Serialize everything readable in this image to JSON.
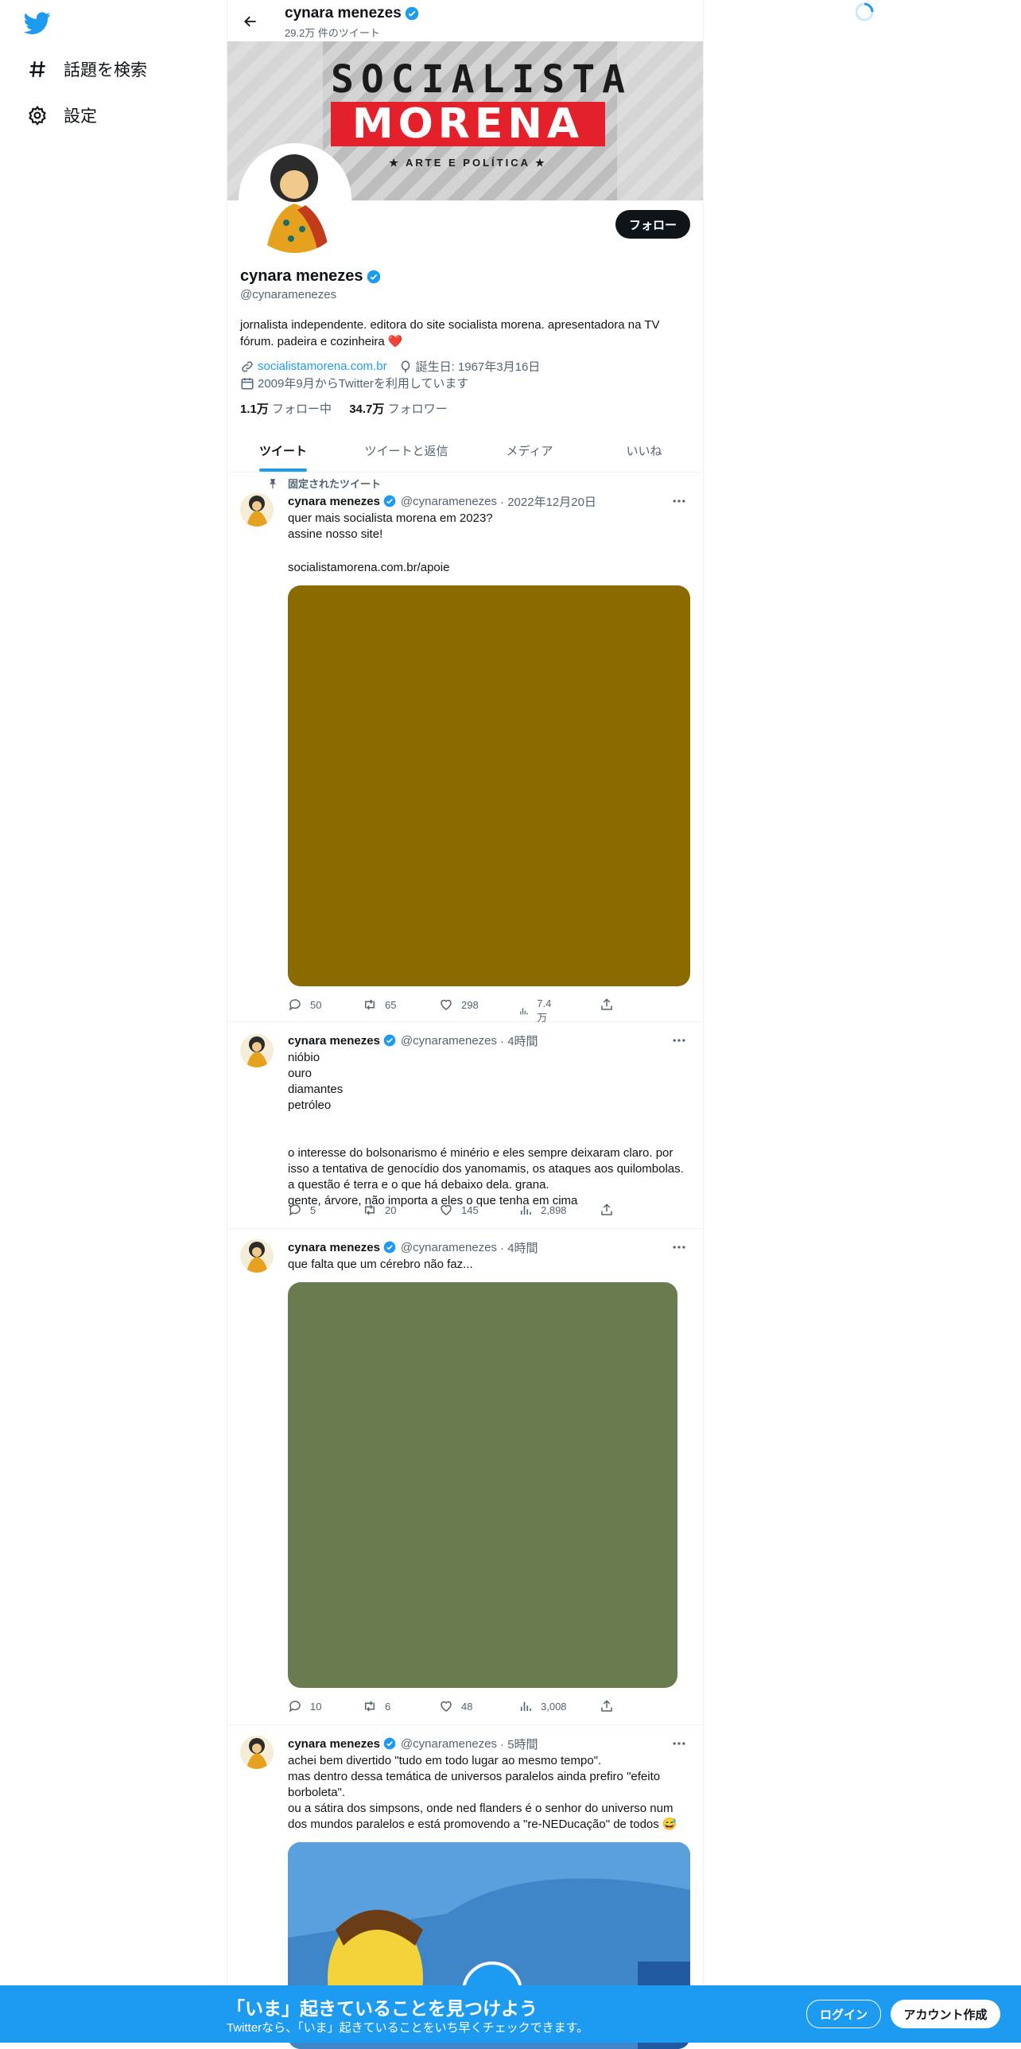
{
  "sidebar": {
    "logo": "twitter-bird-icon",
    "items": [
      {
        "label": "話題を検索",
        "icon": "hashtag-icon"
      },
      {
        "label": "設定",
        "icon": "gear-icon"
      }
    ]
  },
  "header": {
    "name": "cynara menezes",
    "tweet_count": "29.2万 件のツイート"
  },
  "banner": {
    "title_line1": "SOCIALISTA",
    "title_line2": "MORENA",
    "subtitle": "★ ARTE E POLÍTICA ★"
  },
  "profile": {
    "name": "cynara menezes",
    "handle": "@cynaramenezes",
    "bio": "jornalista independente. editora do site socialista morena. apresentadora na TV fórum. padeira e cozinheira ❤️",
    "website": "socialistamorena.com.br",
    "birthday": "誕生日: 1967年3月16日",
    "joined": "2009年9月からTwitterを利用しています",
    "following_count": "1.1万",
    "following_label": " フォロー中",
    "followers_count": "34.7万",
    "followers_label": " フォロワー",
    "follow_button": "フォロー"
  },
  "tabs": [
    "ツイート",
    "ツイートと返信",
    "メディア",
    "いいね"
  ],
  "pinned_label": "固定されたツイート",
  "tweets": [
    {
      "name": "cynara menezes",
      "handle": "@cynaramenezes",
      "time": "· 2022年12月20日",
      "text": "quer mais socialista morena em 2023?\nassine nosso site!",
      "link": "socialistamorena.com.br/apoie",
      "media_color": "#8b6b00",
      "stats": {
        "reply": "50",
        "retweet": "65",
        "like": "298",
        "views": "7.4万"
      }
    },
    {
      "name": "cynara menezes",
      "handle": "@cynaramenezes",
      "time": "· 4時間",
      "text": "nióbio\nouro\ndiamantes\npetróleo\n\n\no interesse do bolsonarismo é minério e eles sempre deixaram claro. por isso a tentativa de genocídio dos yanomamis, os ataques aos quilombolas. a questão é terra e o que há debaixo dela. grana.\ngente, árvore, não importa a eles o que tenha em cima",
      "stats": {
        "reply": "5",
        "retweet": "20",
        "like": "145",
        "views": "2,898"
      }
    },
    {
      "name": "cynara menezes",
      "handle": "@cynaramenezes",
      "time": "· 4時間",
      "text": "que falta que um cérebro não faz...",
      "media_color": "#6a7b50",
      "stats": {
        "reply": "10",
        "retweet": "6",
        "like": "48",
        "views": "3,008"
      }
    },
    {
      "name": "cynara menezes",
      "handle": "@cynaramenezes",
      "time": "· 5時間",
      "text": "achei bem divertido \"tudo em todo lugar ao mesmo tempo\".\nmas dentro dessa temática de universos paralelos ainda prefiro \"efeito borboleta\".\nou a sátira dos simpsons, onde ned flanders é o senhor do universo num dos mundos paralelos e está promovendo a \"re-NEDucação\" de todos 😅"
    }
  ],
  "bottom_bar": {
    "title": "「いま」起きていることを見つけよう",
    "subtitle": "Twitterなら、「いま」起きていることをいち早くチェックできます。",
    "login": "ログイン",
    "signup": "アカウント作成"
  },
  "colors": {
    "accent": "#1d9bf0",
    "text": "#0f1419",
    "muted": "#536471"
  }
}
